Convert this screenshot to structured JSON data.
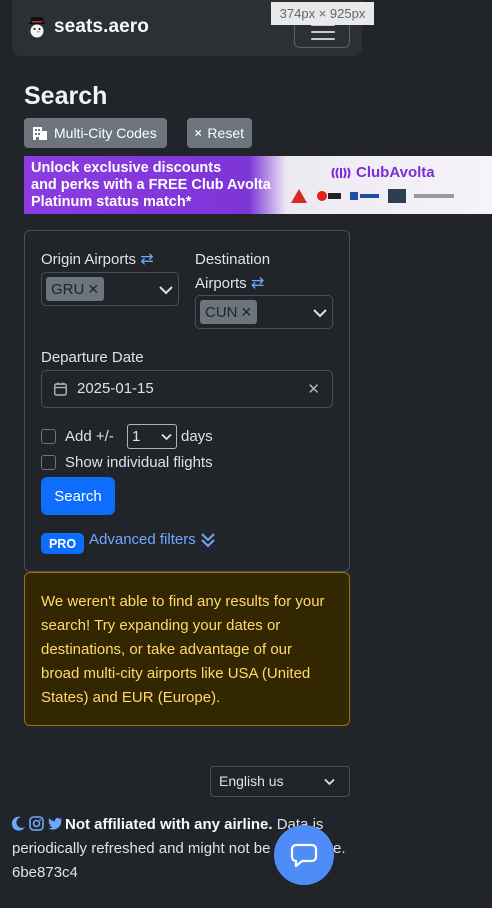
{
  "browser_overlay": {
    "dimensions": "374px × 925px"
  },
  "navbar": {
    "brand": "seats.aero"
  },
  "page": {
    "title": "Search"
  },
  "toolbar": {
    "multi_city": "Multi-City Codes",
    "reset": "Reset"
  },
  "banner": {
    "line1": "Unlock exclusive discounts",
    "line2": "and perks with a FREE Club Avolta",
    "line3": "Platinum status match*",
    "brand": "ClubAvolta"
  },
  "form": {
    "origin_label": "Origin Airports",
    "origin_chip": "GRU",
    "destination_label_1": "Destination",
    "destination_label_2": "Airports",
    "destination_chip": "CUN",
    "departure_label": "Departure Date",
    "departure_value": "2025-01-15",
    "add_label": "Add +/-",
    "add_value": "1",
    "days_label": "days",
    "show_individual": "Show individual flights",
    "search_button": "Search",
    "pro_badge": "PRO",
    "advanced_filters": "Advanced filters"
  },
  "alert": {
    "message": "We weren't able to find any results for your search! Try expanding your dates or destinations, or take advantage of our broad multi-city airports like USA (United States) and EUR (Europe)."
  },
  "footer": {
    "language": "English us",
    "disclaimer_bold": "Not affiliated with any airline.",
    "disclaimer_rest": " Data is periodically refreshed and might not be up to date. 6be873c4"
  },
  "colors": {
    "accent": "#0d6efd",
    "link": "#6ea8fe",
    "warning_text": "#ffda6a",
    "background": "#212529"
  }
}
